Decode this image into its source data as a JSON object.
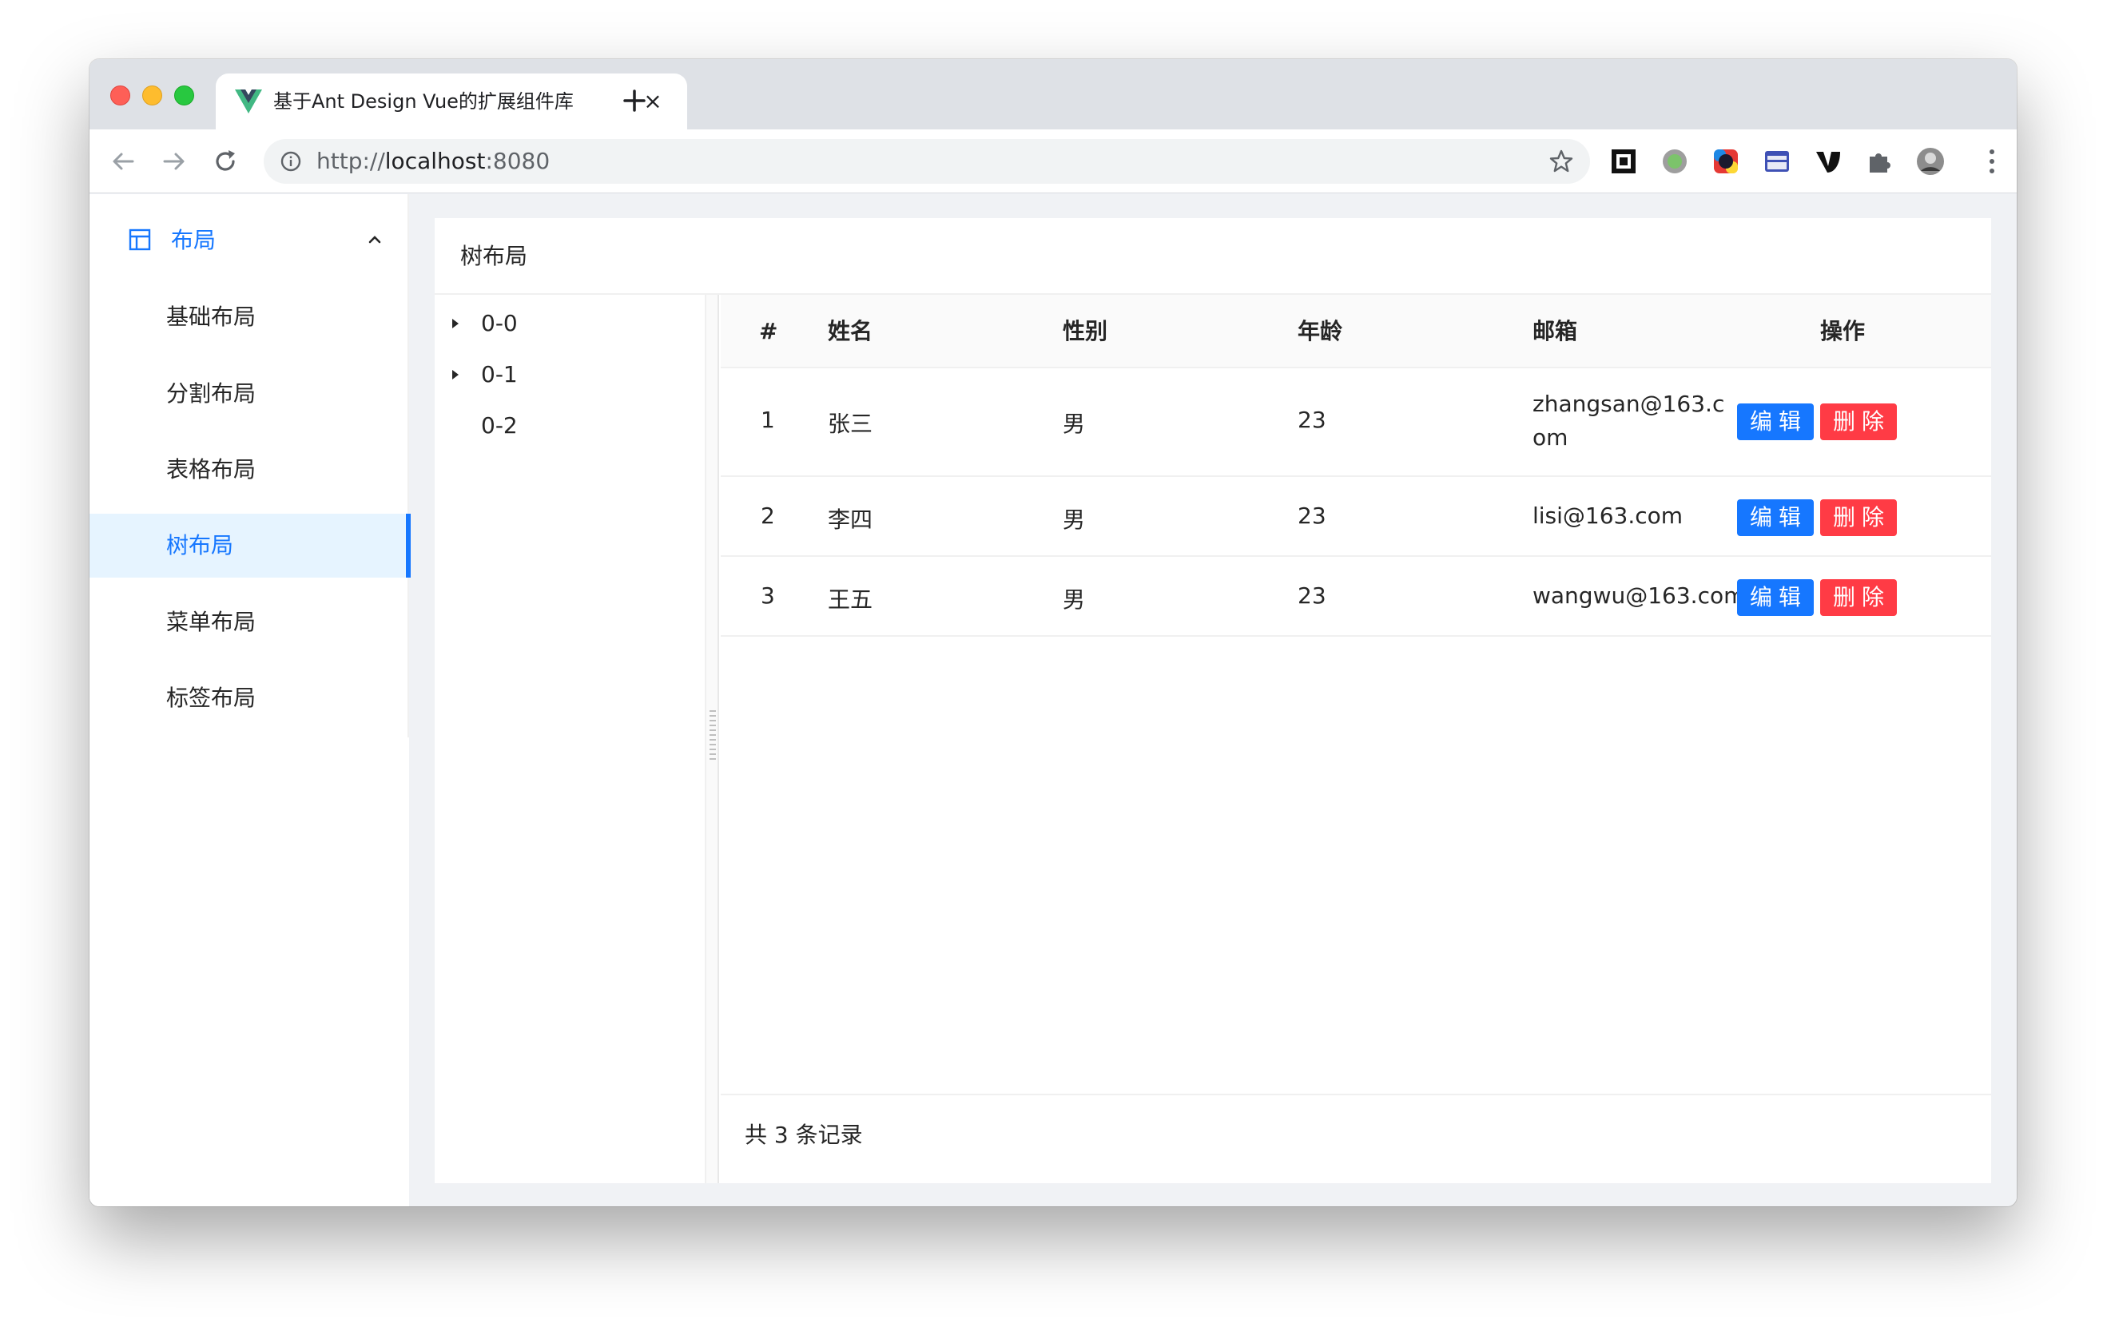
{
  "browser": {
    "tab_title": "基于Ant Design Vue的扩展组件库",
    "close_glyph": "×",
    "new_tab_glyph": "+",
    "url_scheme": "http://",
    "url_host": "localhost",
    "url_port": ":8080"
  },
  "sidebar": {
    "group_label": "布局",
    "items": [
      {
        "label": "基础布局"
      },
      {
        "label": "分割布局"
      },
      {
        "label": "表格布局"
      },
      {
        "label": "树布局"
      },
      {
        "label": "菜单布局"
      },
      {
        "label": "标签布局"
      }
    ],
    "active_index": 3
  },
  "panel": {
    "title": "树布局"
  },
  "tree": {
    "nodes": [
      {
        "label": "0-0",
        "expandable": true
      },
      {
        "label": "0-1",
        "expandable": true
      },
      {
        "label": "0-2",
        "expandable": false
      }
    ]
  },
  "table": {
    "columns": [
      "#",
      "姓名",
      "性别",
      "年龄",
      "邮箱",
      "操作"
    ],
    "rows": [
      {
        "index": "1",
        "name": "张三",
        "gender": "男",
        "age": "23",
        "email": "zhangsan@163.com"
      },
      {
        "index": "2",
        "name": "李四",
        "gender": "男",
        "age": "23",
        "email": "lisi@163.com"
      },
      {
        "index": "3",
        "name": "王五",
        "gender": "男",
        "age": "23",
        "email": "wangwu@163.com"
      }
    ],
    "edit_label": "编辑",
    "delete_label": "删除",
    "footer": "共 3 条记录"
  },
  "colors": {
    "primary": "#1677ff",
    "danger": "#ff3b45",
    "active_bg": "#e6f4ff"
  }
}
